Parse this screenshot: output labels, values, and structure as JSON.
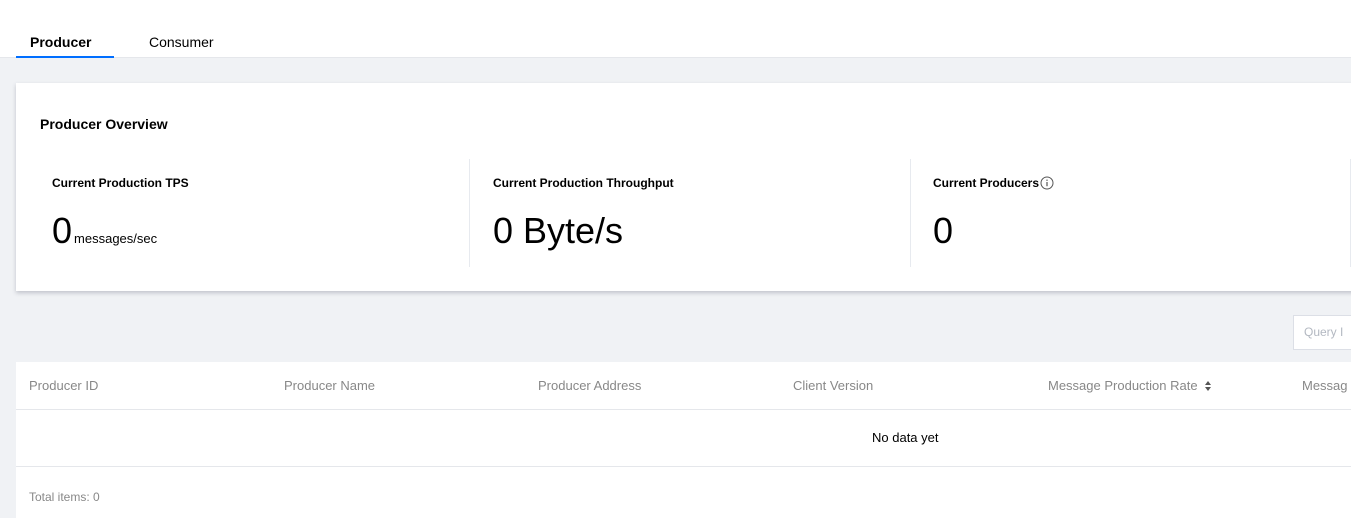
{
  "tabs": [
    {
      "label": "Producer",
      "active": true
    },
    {
      "label": "Consumer",
      "active": false
    }
  ],
  "overview": {
    "title": "Producer Overview",
    "metrics": [
      {
        "label": "Current Production TPS",
        "value": "0",
        "unit": "messages/sec"
      },
      {
        "label": "Current Production Throughput",
        "value": "0 Byte/s",
        "unit": ""
      },
      {
        "label": "Current Producers",
        "value": "0",
        "unit": "",
        "icon": "info-icon"
      }
    ]
  },
  "search": {
    "placeholder": "Query I"
  },
  "table": {
    "columns": [
      {
        "label": "Producer ID"
      },
      {
        "label": "Producer Name"
      },
      {
        "label": "Producer Address"
      },
      {
        "label": "Client Version"
      },
      {
        "label": "Message Production Rate",
        "sortable": true
      },
      {
        "label": "Messag"
      }
    ],
    "empty_text": "No data yet",
    "total_label": "Total items: 0"
  },
  "colors": {
    "accent": "#006eff",
    "page_bg": "#f0f2f5",
    "muted_text": "#888888"
  }
}
